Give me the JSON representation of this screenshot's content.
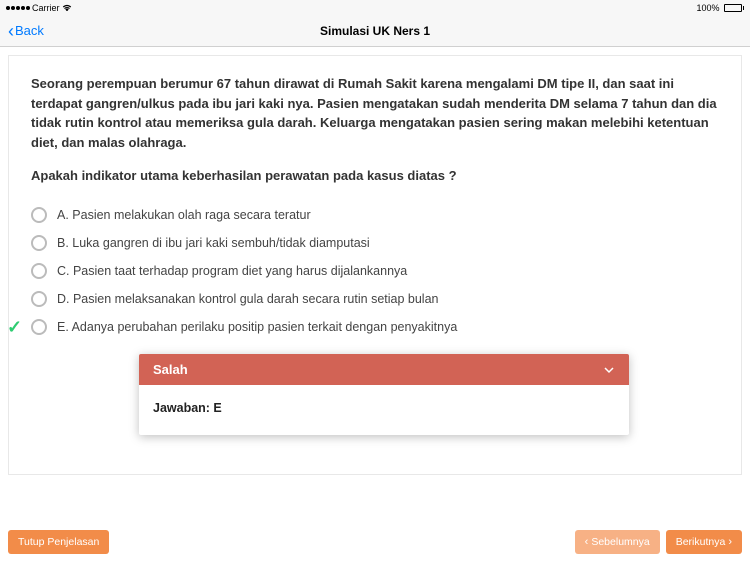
{
  "status": {
    "carrier": "Carrier",
    "battery_pct": "100%"
  },
  "nav": {
    "back_label": "Back",
    "title": "Simulasi UK Ners 1"
  },
  "question": {
    "body": "Seorang perempuan berumur 67 tahun dirawat di Rumah Sakit karena mengalami DM tipe II, dan saat ini terdapat gangren/ulkus pada ibu jari kaki nya. Pasien mengatakan sudah menderita DM selama 7 tahun dan dia tidak rutin kontrol atau memeriksa gula darah. Keluarga mengatakan pasien sering makan melebihi ketentuan diet, dan malas olahraga.",
    "prompt": "Apakah indikator utama keberhasilan perawatan pada kasus diatas ?"
  },
  "options": {
    "a": "A. Pasien melakukan olah raga secara teratur",
    "b": "B. Luka gangren di ibu jari kaki sembuh/tidak diamputasi",
    "c": "C. Pasien taat terhadap program diet yang harus dijalankannya",
    "d": "D. Pasien melaksanakan kontrol gula darah secara rutin setiap bulan",
    "e": "E. Adanya perubahan perilaku positip pasien terkait dengan penyakitnya"
  },
  "answer_panel": {
    "header": "Salah",
    "body": "Jawaban: E"
  },
  "footer": {
    "close_explain": "Tutup Penjelasan",
    "prev": "Sebelumnya",
    "next": "Berikutnya"
  }
}
